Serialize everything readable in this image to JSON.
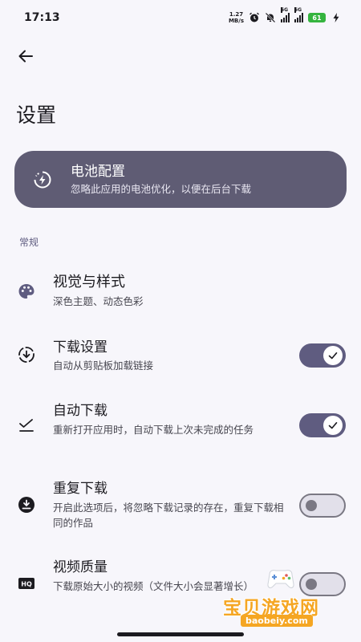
{
  "status_bar": {
    "time": "17:13",
    "net_speed_value": "1.27",
    "net_speed_unit": "MB/s",
    "sim1": "5G",
    "sim2": "5G",
    "battery": "61"
  },
  "header": {
    "title": "设置"
  },
  "battery_card": {
    "title": "电池配置",
    "subtitle": "忽略此应用的电池优化，以便在后台下载",
    "icon": "battery-bolt-icon"
  },
  "section": {
    "label": "常规"
  },
  "settings": [
    {
      "title": "视觉与样式",
      "subtitle": "深色主题、动态色彩",
      "icon": "palette-icon",
      "toggle": null
    },
    {
      "title": "下载设置",
      "subtitle": "自动从剪贴板加载链接",
      "icon": "download-circle-icon",
      "toggle": "on"
    },
    {
      "title": "自动下载",
      "subtitle": "重新打开应用时，自动下载上次未完成的任务",
      "icon": "done-line-icon",
      "toggle": "on"
    },
    {
      "title": "重复下载",
      "subtitle": "开启此选项后，将忽略下载记录的存在，重复下载相同的作品",
      "icon": "download-filled-circle-icon",
      "toggle": "off"
    },
    {
      "title": "视频质量",
      "subtitle": "下载原始大小的视频（文件大小会显著增长）",
      "icon": "hq-icon",
      "toggle": "off"
    }
  ],
  "watermark": {
    "text": "宝贝游戏网",
    "url": "baobeiy.com"
  },
  "colors": {
    "accent": "#5f5c80",
    "card_bg": "#5f5c74",
    "background": "#f7f6fb"
  }
}
